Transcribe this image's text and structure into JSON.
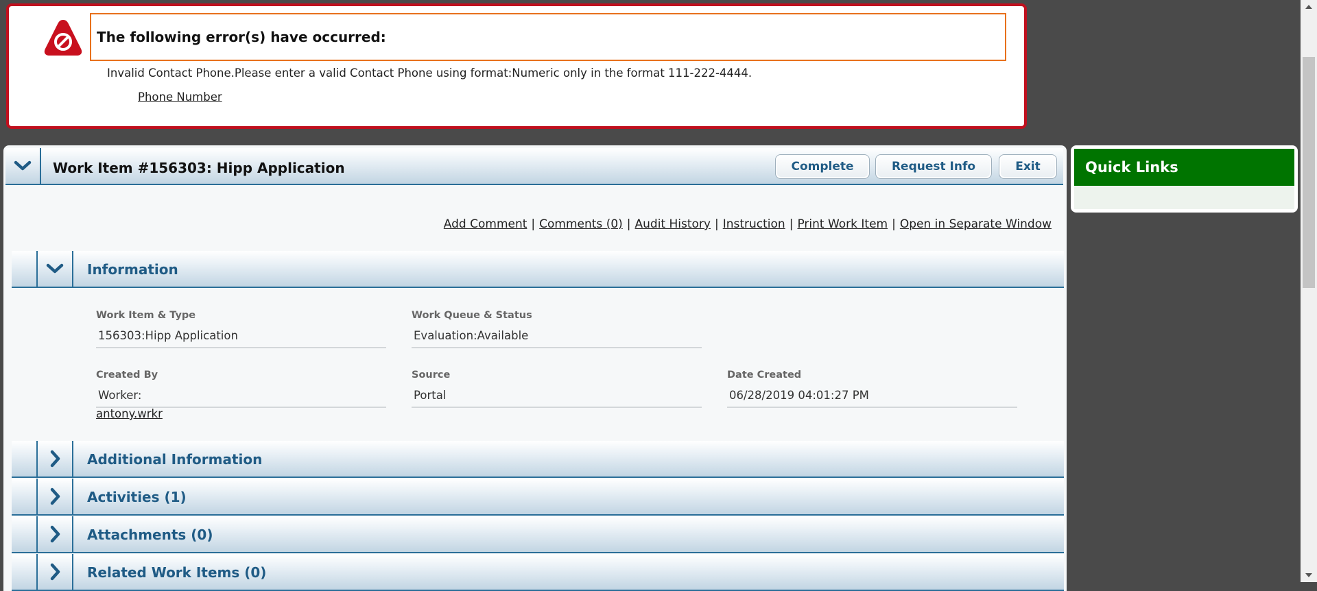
{
  "error": {
    "heading": "The following error(s) have occurred:",
    "message": "Invalid Contact Phone.Please enter a valid Contact Phone using format:Numeric only in the format 111-222-4444.",
    "field_link": "Phone Number",
    "colors": {
      "border": "#c0101e",
      "heading_border": "#e8711c"
    },
    "icon": "no-entry-icon"
  },
  "work_item": {
    "title": "Work Item #156303: Hipp Application",
    "buttons": {
      "complete": "Complete",
      "request_info": "Request Info",
      "exit": "Exit"
    },
    "links": {
      "add_comment": "Add Comment",
      "comments": "Comments (0)",
      "audit_history": "Audit History",
      "instruction": "Instruction",
      "print": "Print Work Item",
      "open_separate": "Open in Separate Window",
      "separator": "|"
    },
    "colors": {
      "accent": "#1f5b85",
      "rule": "#2a6e98"
    }
  },
  "sections": {
    "information": {
      "label": "Information",
      "fields": {
        "work_item_type": {
          "label": "Work Item & Type",
          "value": "156303:Hipp Application"
        },
        "queue_status": {
          "label": "Work Queue & Status",
          "value": "Evaluation:Available"
        },
        "created_by": {
          "label": "Created By",
          "value": "Worker:",
          "link": "antony.wrkr"
        },
        "source": {
          "label": "Source",
          "value": "Portal"
        },
        "date_created": {
          "label": "Date Created",
          "value": "06/28/2019 04:01:27 PM"
        }
      }
    },
    "additional": {
      "label": "Additional Information"
    },
    "activities": {
      "label": "Activities (1)"
    },
    "attachments": {
      "label": "Attachments (0)"
    },
    "related": {
      "label": "Related Work Items (0)"
    }
  },
  "quick_links": {
    "title": "Quick Links",
    "color": "#007400"
  }
}
